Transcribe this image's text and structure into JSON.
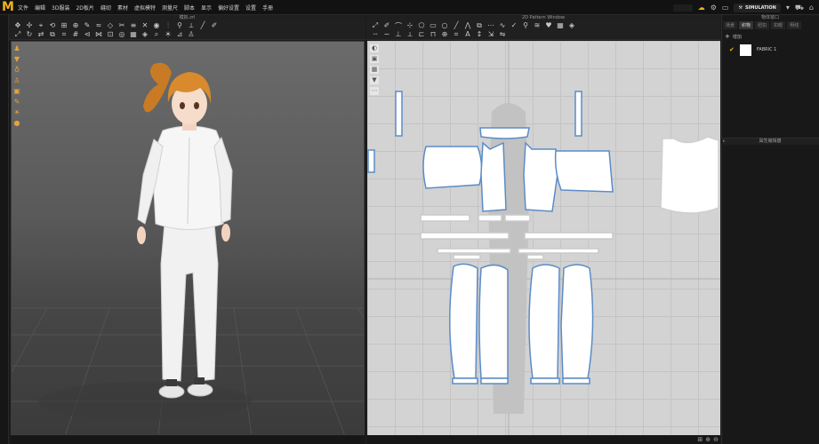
{
  "app": {
    "menu": [
      "文件",
      "编辑",
      "3D服装",
      "2D板片",
      "缝纫",
      "素材",
      "虚拟模特",
      "测量尺",
      "脚本",
      "显示",
      "偏好设置",
      "设置",
      "手册"
    ],
    "simulation_label": "SIMULATION"
  },
  "viewport3d": {
    "title": "模拟.zrl",
    "accent_color": "#e7a33a",
    "side_tools": [
      "avatar-icon",
      "shirt-icon",
      "hanger-icon",
      "person-icon",
      "fabric-icon",
      "pen-icon",
      "sun-icon",
      "ball-icon"
    ]
  },
  "pattern2d": {
    "title": "2D Pattern Window",
    "outline_color": "#5b8cc7"
  },
  "right_panel": {
    "title": "物体窗口",
    "tabs": [
      "场景",
      "织物",
      "纽扣",
      "扣眼",
      "明线"
    ],
    "add_label": "增加",
    "fabric_item": "FABRIC 1",
    "property_title": "属性编辑器"
  }
}
